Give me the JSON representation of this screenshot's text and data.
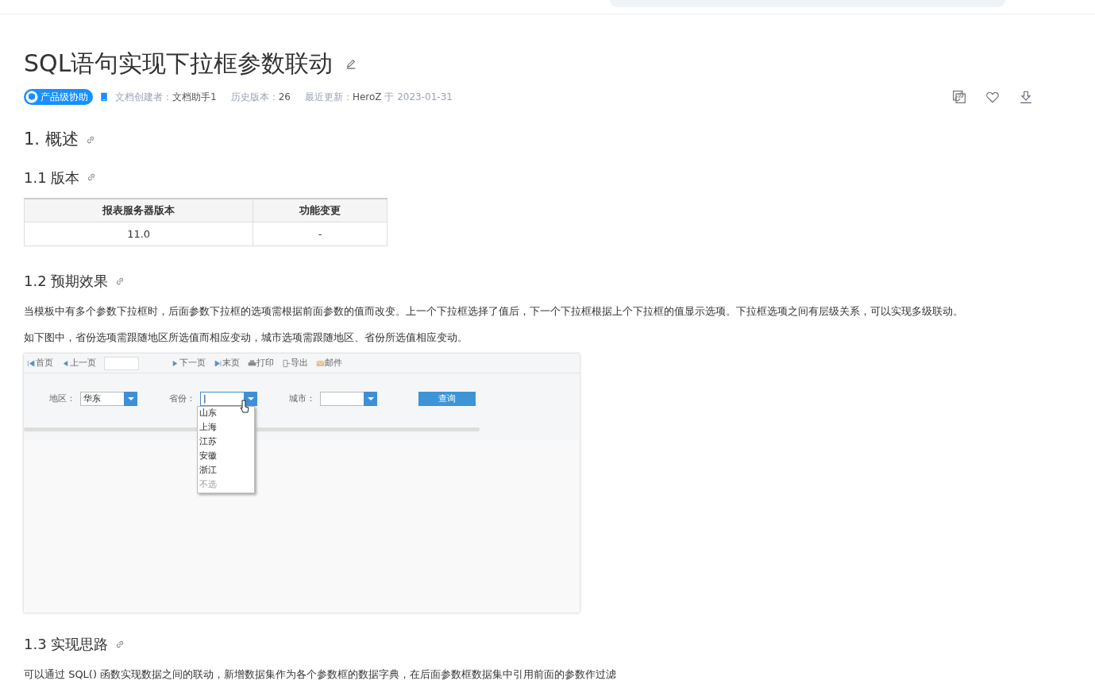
{
  "page": {
    "title": "SQL语句实现下拉框参数联动"
  },
  "meta": {
    "badge": "产品级协助",
    "creator_label": "文档创建者：",
    "creator": "文档助手1",
    "history_label": "历史版本：",
    "history": "26",
    "updated_label": "最近更新：",
    "updated_by": "HeroZ",
    "updated_on": "于 2023-01-31"
  },
  "sections": [
    {
      "kind": "h2",
      "text": "1. 概述"
    },
    {
      "kind": "h3",
      "text": "1.1 版本"
    },
    {
      "kind": "table",
      "columns": [
        "报表服务器版本",
        "功能变更"
      ],
      "rows": [
        [
          "11.0",
          "-"
        ]
      ]
    },
    {
      "kind": "h3",
      "text": "1.2 预期效果"
    },
    {
      "kind": "p",
      "text": "当模板中有多个参数下拉框时，后面参数下拉框的选项需根据前面参数的值而改变。上一个下拉框选择了值后，下一个下拉框根据上个下拉框的值显示选项。下拉框选项之间有层级关系，可以实现多级联动。"
    },
    {
      "kind": "p",
      "text": "如下图中，省份选项需跟随地区所选值而相应变动，城市选项需跟随地区、省份所选值相应变动。"
    },
    {
      "kind": "shot"
    },
    {
      "kind": "h3",
      "text": "1.3 实现思路"
    },
    {
      "kind": "p",
      "text": "可以通过 SQL() 函数实现数据之间的联动，新增数据集作为各个参数框的数据字典，在后面参数框数据集中引用前面的参数作过滤"
    }
  ],
  "screenshot": {
    "toolbar": [
      "首页",
      "上一页",
      "下一页",
      "末页",
      "打印",
      "导出",
      "邮件"
    ],
    "fields": [
      {
        "label": "地区：",
        "value": "华东"
      },
      {
        "label": "省份：",
        "value": "|"
      },
      {
        "label": "城市："
      }
    ],
    "query_button": "查询",
    "dropdown": [
      {
        "text": "山东",
        "disabled": false
      },
      {
        "text": "上海",
        "disabled": false
      },
      {
        "text": "江苏",
        "disabled": false
      },
      {
        "text": "安徽",
        "disabled": false
      },
      {
        "text": "浙江",
        "disabled": false
      },
      {
        "text": "不选",
        "disabled": true
      }
    ]
  }
}
